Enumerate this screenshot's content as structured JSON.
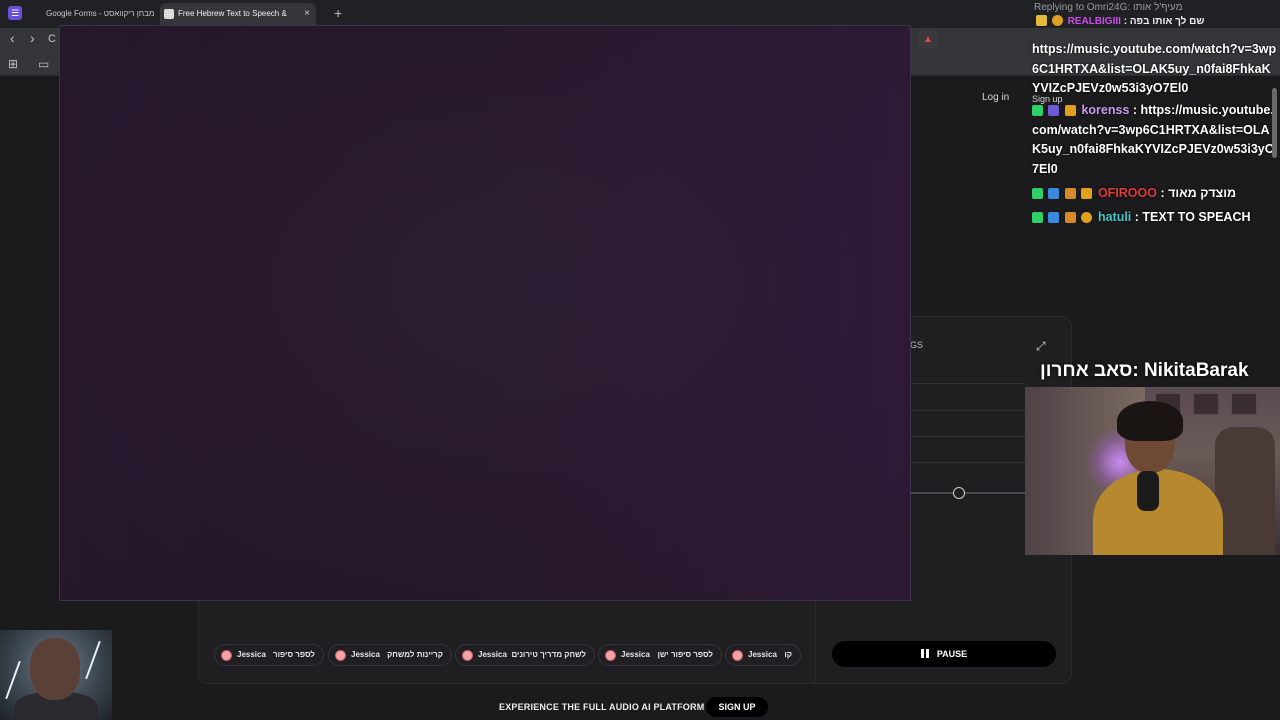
{
  "browser": {
    "tabs": [
      {
        "label": "Google Forms - מבחן ריקוואסט"
      },
      {
        "label": "Free Hebrew Text to Speech &",
        "close": "×"
      }
    ],
    "new_tab": "+",
    "back": "‹",
    "forward": "›",
    "reload": "C"
  },
  "site": {
    "login_label": "Log in",
    "settings_label": "GS",
    "expand_glyph": "⤢",
    "voice_chips": [
      {
        "voice": "Jessica",
        "text": "לספר סיפור"
      },
      {
        "voice": "Jessica",
        "text": "קריינות למשחק"
      },
      {
        "voice": "Jessica",
        "text": "לשחק מדריך טירונים"
      },
      {
        "voice": "Jessica",
        "text": "לספר סיפור ישן"
      },
      {
        "voice": "Jessica",
        "text": "קו"
      }
    ],
    "pause_label": "PAUSE",
    "footer_text": "EXPERIENCE THE FULL AUDIO AI PLATFORM",
    "signup_label": "SIGN UP",
    "volume_level": 0.43
  },
  "chat": {
    "reply_header": "Replying to Omri24G: מעיף'ל אותו",
    "reply_user": "REALBIGIII",
    "reply_text": ": שם לך אותו בפה",
    "signup_small": "Sign up",
    "messages": [
      {
        "user": "",
        "text": "https://music.youtube.com/watch?v=3wp6C1HRTXA&list=OLAK5uy_n0fai8FhkaKYVIZcPJEVz0w53i3yO7El0"
      },
      {
        "user": "korenss",
        "user_color": "#c99cf2",
        "text": " : https://music.youtube.com/watch?v=3wp6C1HRTXA&list=OLAK5uy_n0fai8FhkaKYVIZcPJEVz0w53i3yO7El0"
      },
      {
        "user": "OFIROOO",
        "user_color": "#e03a3a",
        "text": " : מוצדק מאוד"
      },
      {
        "user": "hatuli",
        "user_color": "#46c6c6",
        "text": " : TEXT TO SPEACH"
      }
    ]
  },
  "stream": {
    "last_sub": "סאב אחרון: NikitaBarak"
  }
}
